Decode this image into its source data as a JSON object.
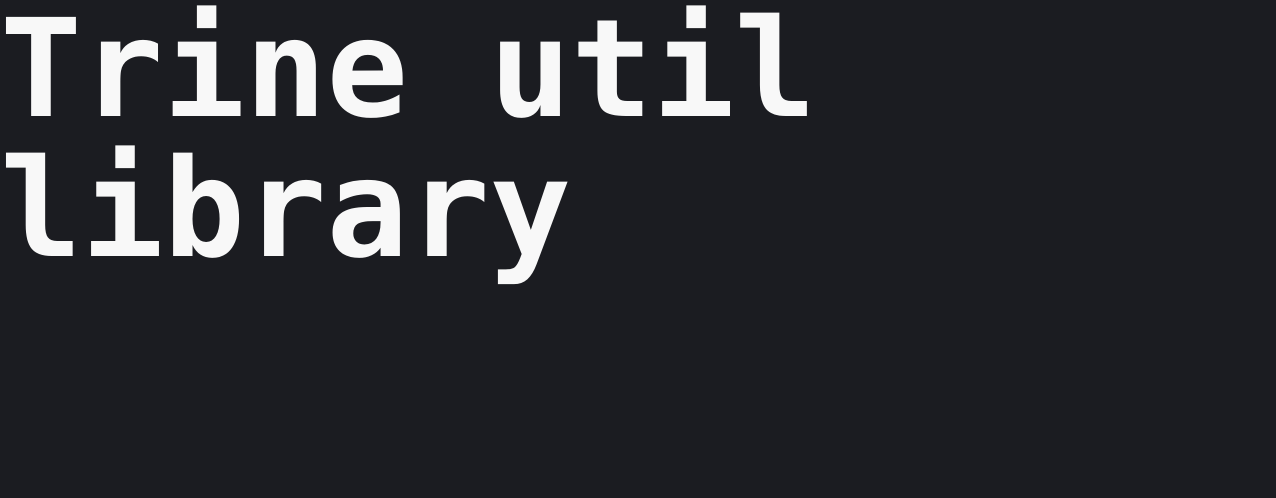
{
  "hero": {
    "title_line_1": "Trine util",
    "title_line_2": "library"
  },
  "colors": {
    "background": "#1b1c21",
    "text": "#f8f8f8"
  }
}
